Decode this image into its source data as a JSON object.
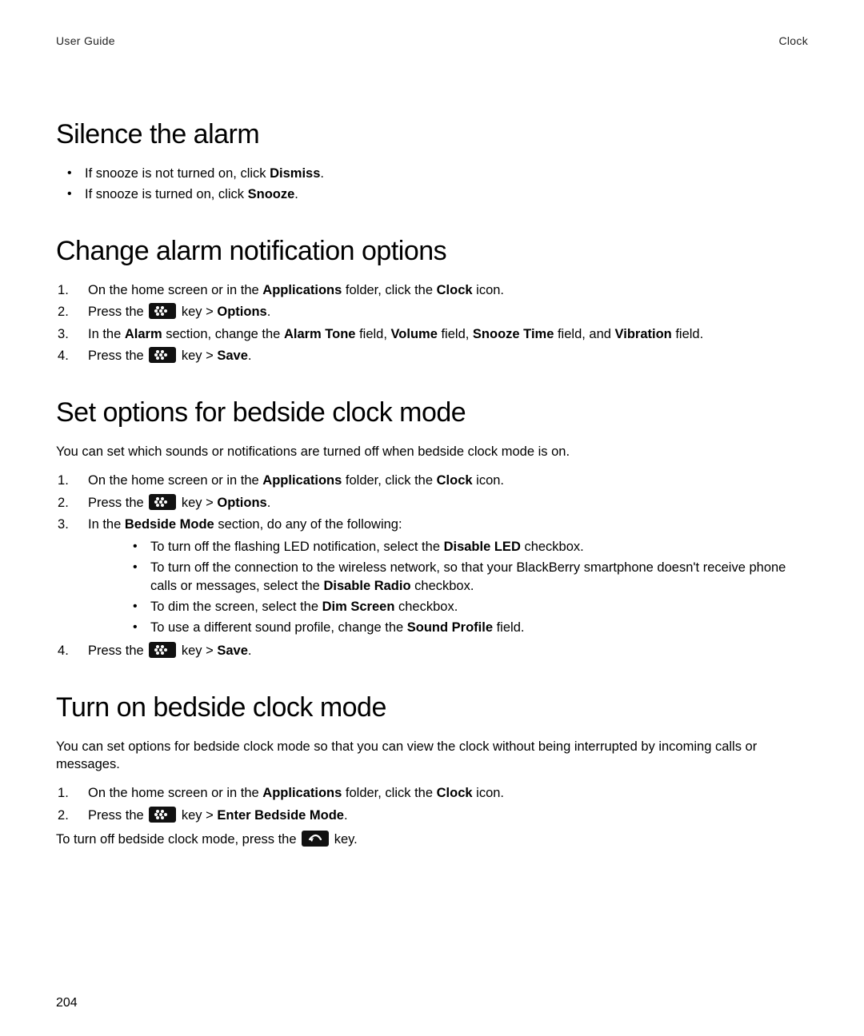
{
  "header": {
    "left": "User Guide",
    "right": "Clock"
  },
  "page_number": "204",
  "silence": {
    "title": "Silence the alarm",
    "bullets": {
      "a": {
        "pre": "If snooze is not turned on, click ",
        "bold": "Dismiss",
        "post": "."
      },
      "b": {
        "pre": "If snooze is turned on, click ",
        "bold": "Snooze",
        "post": "."
      }
    }
  },
  "change": {
    "title": "Change alarm notification options",
    "steps": {
      "s1": {
        "pre": "On the home screen or in the ",
        "b1": "Applications",
        "mid": " folder, click the ",
        "b2": "Clock",
        "post": " icon."
      },
      "s2": {
        "pre": "Press the ",
        "mid": " key > ",
        "bold": "Options",
        "post": "."
      },
      "s3": {
        "a": "In the ",
        "b1": "Alarm",
        "c": " section, change the ",
        "b2": "Alarm Tone",
        "d": " field, ",
        "b3": "Volume",
        "e": " field, ",
        "b4": "Snooze Time",
        "f": " field, and ",
        "b5": "Vibration",
        "g": " field."
      },
      "s4": {
        "pre": "Press the ",
        "mid": " key > ",
        "bold": "Save",
        "post": "."
      }
    }
  },
  "bedopts": {
    "title": "Set options for bedside clock mode",
    "desc": "You can set which sounds or notifications are turned off when bedside clock mode is on.",
    "steps": {
      "s1": {
        "pre": "On the home screen or in the ",
        "b1": "Applications",
        "mid": " folder, click the ",
        "b2": "Clock",
        "post": " icon."
      },
      "s2": {
        "pre": "Press the ",
        "mid": " key > ",
        "bold": "Options",
        "post": "."
      },
      "s3": {
        "pre": "In the ",
        "b1": "Bedside Mode",
        "post": " section, do any of the following:"
      },
      "sub": {
        "a": {
          "pre": "To turn off the flashing LED notification, select the ",
          "bold": "Disable LED",
          "post": " checkbox."
        },
        "b": {
          "pre": "To turn off the connection to the wireless network, so that your BlackBerry smartphone doesn't receive phone calls or messages, select the ",
          "bold": "Disable Radio",
          "post": " checkbox."
        },
        "c": {
          "pre": "To dim the screen, select the ",
          "bold": "Dim Screen",
          "post": " checkbox."
        },
        "d": {
          "pre": "To use a different sound profile, change the ",
          "bold": "Sound Profile",
          "post": " field."
        }
      },
      "s4": {
        "pre": "Press the ",
        "mid": " key > ",
        "bold": "Save",
        "post": "."
      }
    }
  },
  "bedon": {
    "title": "Turn on bedside clock mode",
    "desc": "You can set options for bedside clock mode so that you can view the clock without being interrupted by incoming calls or messages.",
    "steps": {
      "s1": {
        "pre": "On the home screen or in the ",
        "b1": "Applications",
        "mid": " folder, click the ",
        "b2": "Clock",
        "post": " icon."
      },
      "s2": {
        "pre": "Press the ",
        "mid": " key > ",
        "bold": "Enter Bedside Mode",
        "post": "."
      }
    },
    "note": {
      "pre": "To turn off bedside clock mode, press the ",
      "post": " key."
    }
  }
}
